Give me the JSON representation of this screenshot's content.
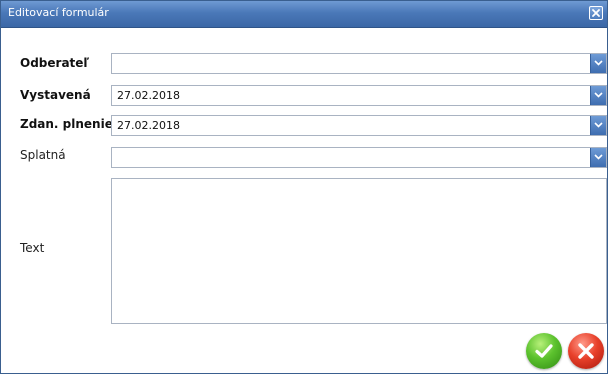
{
  "window": {
    "title": "Editovací formulár"
  },
  "form": {
    "rows": [
      {
        "label": "Odberateľ",
        "value": ""
      },
      {
        "label": "Vystavená",
        "value": "27.02.2018"
      },
      {
        "label": "Zdan. plnenie",
        "value": "27.02.2018"
      },
      {
        "label": "Splatná",
        "value": ""
      }
    ],
    "text_label": "Text",
    "text_value": ""
  },
  "icons": {
    "close": "close-icon",
    "dropdown": "chevron-down-icon",
    "confirm": "checkmark-icon",
    "cancel": "x-icon"
  },
  "colors": {
    "titlebar": "#4a78b8",
    "confirm": "#3fa81c",
    "cancel": "#d9301c"
  }
}
